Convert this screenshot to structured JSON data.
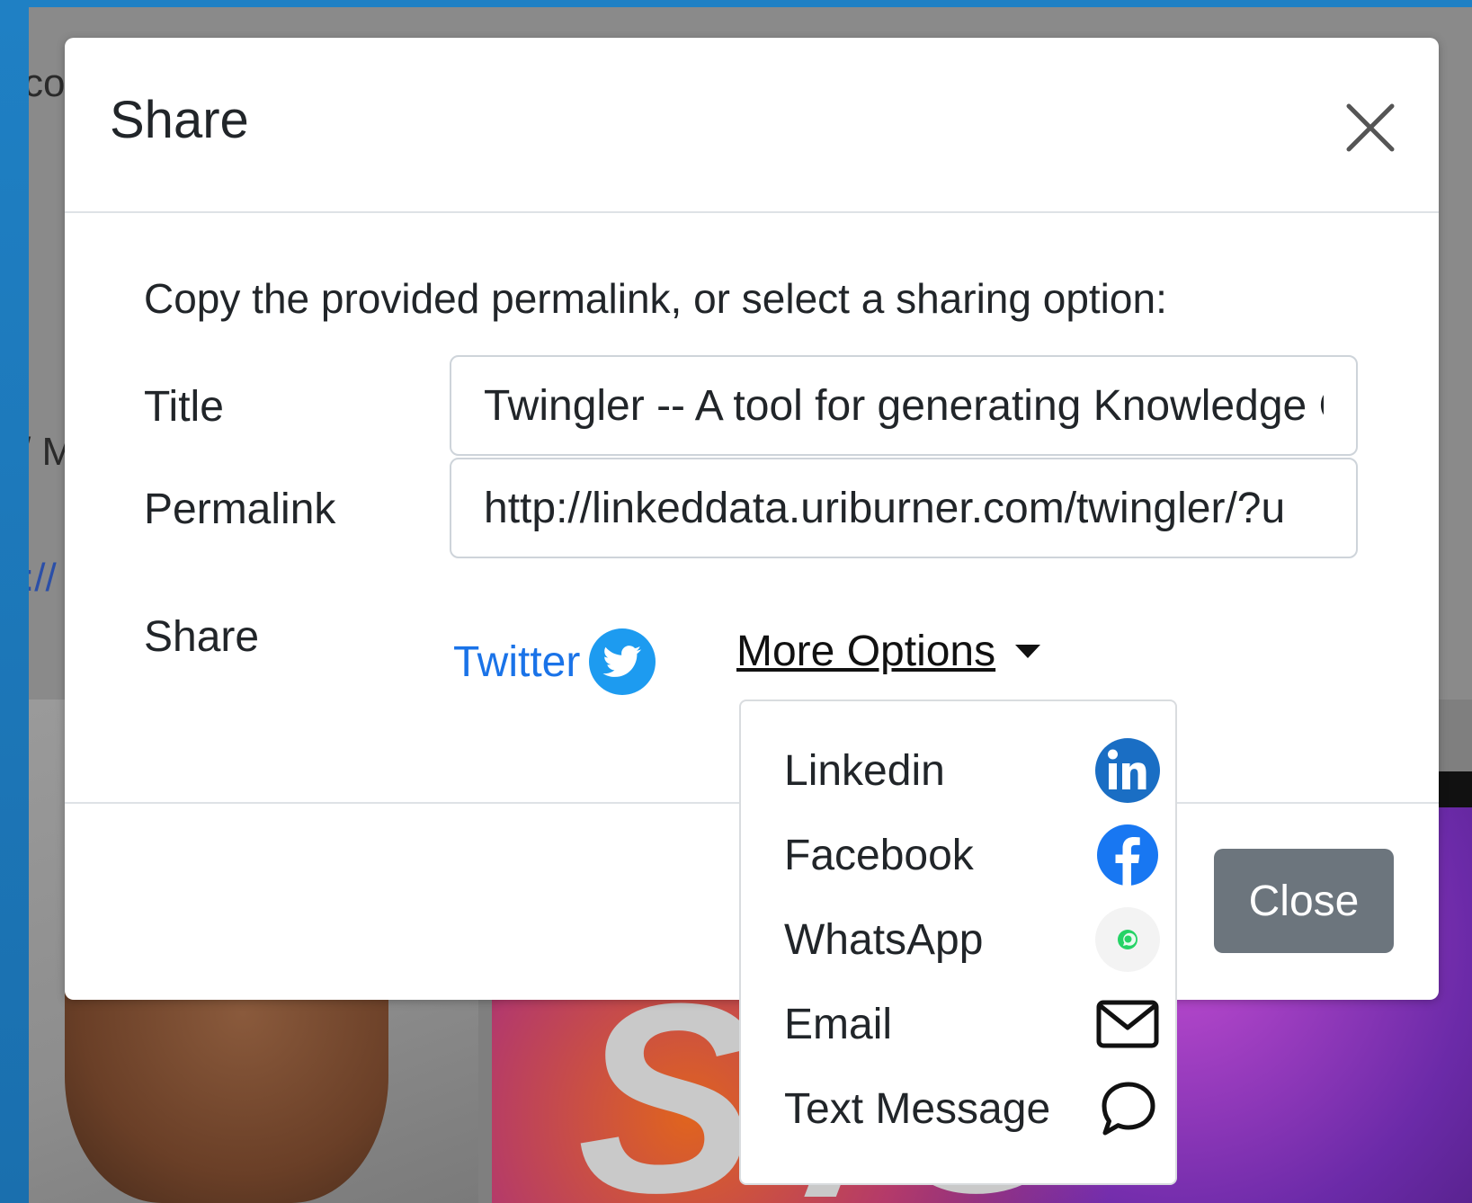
{
  "background": {
    "fragment_top": "co",
    "fragment_mid": "/ M",
    "fragment_link": "://",
    "image_text": "S   /O"
  },
  "modal": {
    "title": "Share",
    "close_icon": "close-icon",
    "intro": "Copy the provided permalink, or select a sharing option:",
    "fields": {
      "title_label": "Title",
      "title_value": "Twingler -- A tool for generating Knowledge Graphs",
      "permalink_label": "Permalink",
      "permalink_value": "http://linkeddata.uriburner.com/twingler/?u"
    },
    "share": {
      "label": "Share",
      "twitter_label": "Twitter",
      "more_options_label": "More Options"
    },
    "dropdown": {
      "items": [
        {
          "label": "Linkedin",
          "icon": "linkedin-icon"
        },
        {
          "label": "Facebook",
          "icon": "facebook-icon"
        },
        {
          "label": "WhatsApp",
          "icon": "whatsapp-icon"
        },
        {
          "label": "Email",
          "icon": "email-icon"
        },
        {
          "label": "Text Message",
          "icon": "text-message-icon"
        }
      ]
    },
    "footer": {
      "close_label": "Close"
    }
  },
  "colors": {
    "twitter": "#1d9bf0",
    "link": "#1a73e8",
    "linkedin": "#1a6ec4",
    "facebook": "#1877f2",
    "whatsapp": "#25d366",
    "secondary_button": "#6c757d"
  }
}
